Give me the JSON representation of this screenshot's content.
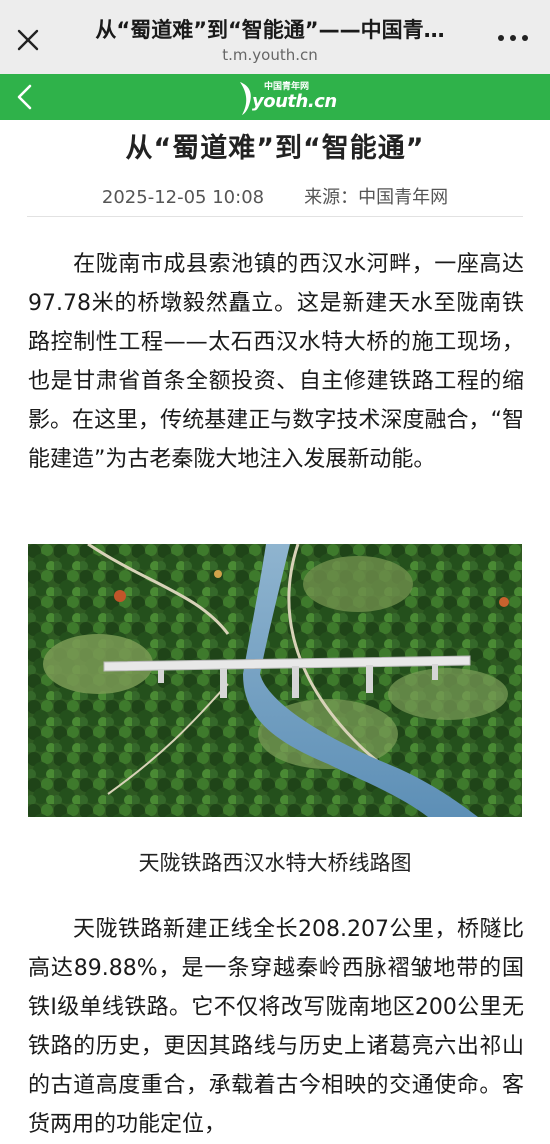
{
  "browser": {
    "title": "从“蜀道难”到“智能通”——中国青…",
    "url": "t.m.youth.cn"
  },
  "site": {
    "logo_cn": "中国青年网",
    "logo_en": "youth.cn",
    "brand_color": "#2fb24a"
  },
  "article": {
    "title": "从“蜀道难”到“智能通”",
    "date": "2025-12-05 10:08",
    "source": "来源：中国青年网",
    "paragraph1": "在陇南市成县索池镇的西汉水河畔，一座高达97.78米的桥墩毅然矗立。这是新建天水至陇南铁路控制性工程——太石西汉水特大桥的施工现场，也是甘肃省首条全额投资、自主修建铁路工程的缩影。在这里，传统基建正与数字技术深度融合，“智能建造”为古老秦陇大地注入发展新动能。",
    "image_caption": "天陇铁路西汉水特大桥线路图",
    "paragraph2": "天陇铁路新建正线全长208.207公里，桥隧比高达89.88%，是一条穿越秦岭西脉褶皱地带的国铁Ⅰ级单线铁路。它不仅将改写陇南地区200公里无铁路的历史，更因其路线与历史上诸葛亮六出祁山的古道高度重合，承载着古今相映的交通使命。客货两用的功能定位，"
  },
  "icons": {
    "close": "close-icon",
    "more": "more-icon",
    "back": "chevron-left-icon"
  }
}
